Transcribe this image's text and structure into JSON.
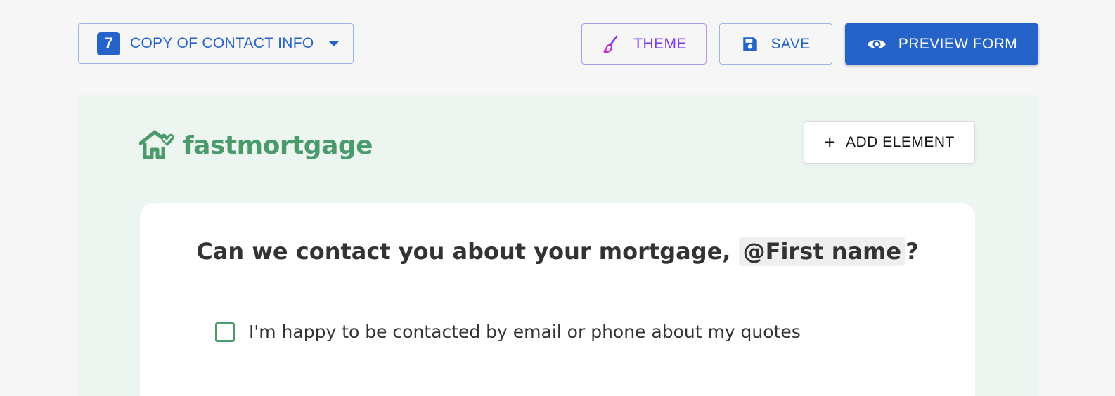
{
  "toolbar": {
    "form_number": "7",
    "form_name": "COPY OF CONTACT INFO",
    "theme_label": "THEME",
    "save_label": "SAVE",
    "preview_label": "PREVIEW FORM"
  },
  "canvas": {
    "logo_text": "fastmortgage",
    "add_element_label": "ADD ELEMENT",
    "question": {
      "prefix": "Can we contact you about your mortgage,",
      "merge_tag": "@First name",
      "suffix": "?"
    },
    "consent_label": "I'm happy to be contacted by email or phone about my quotes",
    "consent_checked": false
  },
  "colors": {
    "primary": "#2563c9",
    "theme_accent": "#7c3aed",
    "brand_green": "#4a9a6c",
    "canvas_bg": "#edf5f1",
    "page_bg": "#f6f6f7"
  },
  "icons": {
    "theme": "paintbrush-icon",
    "save": "floppy-disk-icon",
    "preview": "eye-icon",
    "dropdown": "caret-down-icon",
    "logo": "house-heart-icon",
    "add": "plus-icon"
  }
}
